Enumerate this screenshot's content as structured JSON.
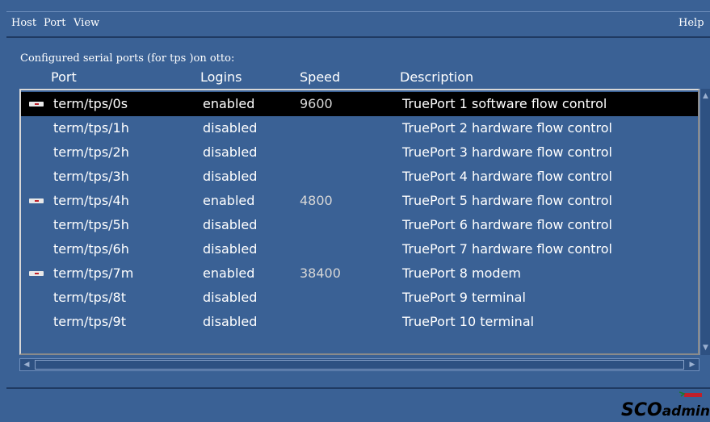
{
  "menu": {
    "host": "Host",
    "port": "Port",
    "view": "View",
    "help": "Help"
  },
  "caption": "Configured serial ports (for tps )on otto:",
  "columns": {
    "port": "Port",
    "logins": "Logins",
    "speed": "Speed",
    "description": "Description"
  },
  "rows": [
    {
      "port": "term/tps/0s",
      "logins": "enabled",
      "speed": "9600",
      "description": "TruePort 1 software flow control",
      "icon": "port-enabled-icon",
      "selected": true
    },
    {
      "port": "term/tps/1h",
      "logins": "disabled",
      "speed": "",
      "description": "TruePort 2 hardware flow control"
    },
    {
      "port": "term/tps/2h",
      "logins": "disabled",
      "speed": "",
      "description": "TruePort 3 hardware flow control"
    },
    {
      "port": "term/tps/3h",
      "logins": "disabled",
      "speed": "",
      "description": "TruePort 4 hardware flow control"
    },
    {
      "port": "term/tps/4h",
      "logins": "enabled",
      "speed": "4800",
      "description": "TruePort 5 hardware flow control",
      "icon": "port-enabled-icon"
    },
    {
      "port": "term/tps/5h",
      "logins": "disabled",
      "speed": "",
      "description": "TruePort 6 hardware flow control"
    },
    {
      "port": "term/tps/6h",
      "logins": "disabled",
      "speed": "",
      "description": "TruePort 7 hardware flow control"
    },
    {
      "port": "term/tps/7m",
      "logins": "enabled",
      "speed": "38400",
      "description": "TruePort 8 modem",
      "icon": "port-enabled-icon"
    },
    {
      "port": "term/tps/8t",
      "logins": "disabled",
      "speed": "",
      "description": "TruePort 9 terminal"
    },
    {
      "port": "term/tps/9t",
      "logins": "disabled",
      "speed": "",
      "description": "TruePort 10 terminal"
    }
  ],
  "logo": {
    "sco": "SCO",
    "admin": "admin",
    "icon": "scoadmin-logo-icon"
  },
  "colors": {
    "background": "#3a6195",
    "selected_row": "#000000",
    "text": "#ffffff"
  }
}
